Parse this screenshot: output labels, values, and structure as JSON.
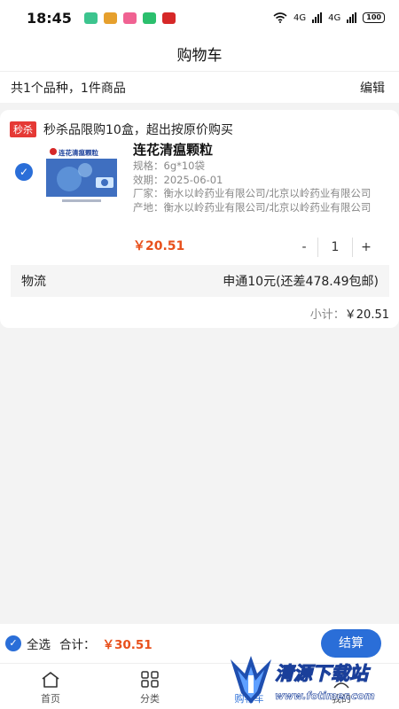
{
  "status_bar": {
    "time": "18:45",
    "net1": "4G",
    "net2": "4G",
    "battery": "100"
  },
  "header": {
    "title": "购物车"
  },
  "summary": {
    "text": "共1个品种，1件商品",
    "edit_label": "编辑"
  },
  "promo": {
    "tag": "秒杀",
    "text": "秒杀品限购10盒，超出按原价购买"
  },
  "product": {
    "name": "连花清瘟颗粒",
    "box_label": "连花清瘟颗粒",
    "spec": "规格：6g*10袋",
    "expiry": "效期：2025-06-01",
    "maker": "厂家：衡水以岭药业有限公司/北京以岭药业有限公司",
    "origin": "产地：衡水以岭药业有限公司/北京以岭药业有限公司",
    "price": "￥20.51",
    "quantity": "1",
    "minus": "-",
    "plus": "+"
  },
  "logistics": {
    "label": "物流",
    "value": "申通10元(还差478.49包邮)"
  },
  "subtotal": {
    "label": "小计：",
    "value": "￥20.51"
  },
  "checkout": {
    "select_all": "全选",
    "total_label": "合计：",
    "total_value": "￥30.51",
    "pay_label": "结算"
  },
  "tabs": [
    {
      "label": "首页",
      "icon": "home-icon"
    },
    {
      "label": "分类",
      "icon": "grid-icon"
    },
    {
      "label": "购物车",
      "icon": "cart-icon"
    },
    {
      "label": "我的",
      "icon": "user-icon"
    }
  ],
  "watermark": {
    "title": "清源下载站",
    "url": "www.fotimer.com"
  },
  "colors": {
    "accent": "#2a6ed8",
    "price": "#e8501c",
    "tag": "#e53935"
  }
}
